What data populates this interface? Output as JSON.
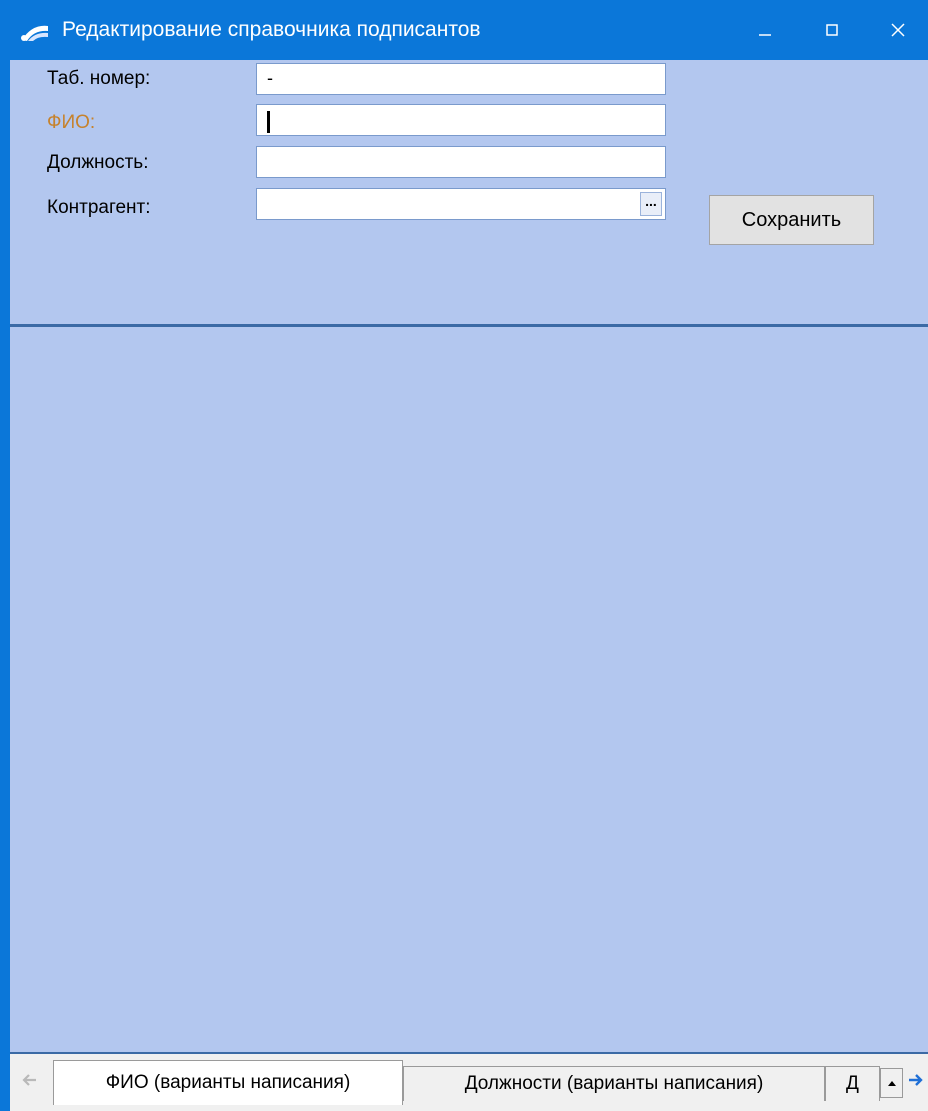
{
  "window": {
    "title": "Редактирование справочника подписантов",
    "controls": {
      "minimize": "minimize-icon",
      "maximize": "maximize-icon",
      "close": "close-icon"
    }
  },
  "form": {
    "tab_number": {
      "label": "Таб. номер:",
      "value": "-"
    },
    "fio": {
      "label": "ФИО:",
      "value": ""
    },
    "position": {
      "label": "Должность:",
      "value": ""
    },
    "counterparty": {
      "label": "Контрагент:",
      "value": "",
      "browse_label": "..."
    },
    "save_label": "Сохранить"
  },
  "tabs": [
    {
      "label": "ФИО (варианты написания)",
      "active": true
    },
    {
      "label": "Должности (варианты написания)",
      "active": false
    },
    {
      "label": "Д",
      "active": false
    }
  ],
  "colors": {
    "titlebar": "#0b77d9",
    "panel": "#b3c7ef",
    "required_label": "#c6822c"
  }
}
